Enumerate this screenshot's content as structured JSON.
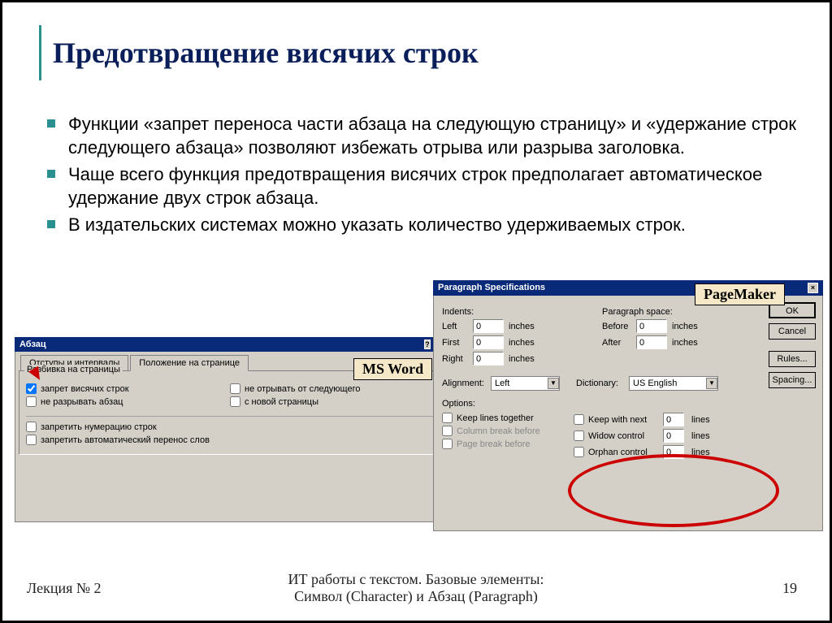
{
  "title": "Предотвращение висячих строк",
  "bullets": [
    "Функции «запрет переноса части абзаца на следующую страницу» и «удержание строк следующего абзаца» позволяют избежать отрыва или разрыва заголовка.",
    "Чаще всего функция предотвращения висячих строк предполагает автоматическое удержание двух строк абзаца.",
    "В издательских системах можно указать количество удерживаемых строк."
  ],
  "tags": {
    "msword": "MS Word",
    "pagemaker": "PageMaker"
  },
  "msword": {
    "window_title": "Абзац",
    "tabs": [
      "Отступы и интервалы",
      "Положение на странице"
    ],
    "group": "Разбивка на страницы",
    "chk": {
      "widow": "запрет висячих строк",
      "keep_together": "не разрывать абзац",
      "keep_next": "не отрывать от следующего",
      "page_break": "с новой страницы",
      "suppress_num": "запретить нумерацию строк",
      "no_hyphen": "запретить автоматический перенос слов"
    }
  },
  "pm": {
    "window_title": "Paragraph Specifications",
    "labels": {
      "indents": "Indents:",
      "para_space": "Paragraph space:",
      "left": "Left",
      "first": "First",
      "right": "Right",
      "before": "Before",
      "after": "After",
      "inches": "inches",
      "alignment": "Alignment:",
      "dictionary": "Dictionary:",
      "options": "Options:",
      "keep_lines": "Keep lines together",
      "col_break": "Column break before",
      "page_break": "Page break before",
      "keep_next": "Keep with next",
      "widow": "Widow control",
      "orphan": "Orphan control",
      "lines": "lines"
    },
    "values": {
      "left": "0",
      "first": "0",
      "right": "0",
      "before": "0",
      "after": "0",
      "alignment": "Left",
      "dictionary": "US English",
      "keep_next": "0",
      "widow": "0",
      "orphan": "0"
    },
    "buttons": {
      "ok": "OK",
      "cancel": "Cancel",
      "rules": "Rules...",
      "spacing": "Spacing..."
    }
  },
  "footer": {
    "left": "Лекция № 2",
    "center1": "ИТ работы с текстом. Базовые элементы:",
    "center2": "Символ (Character)  и Абзац (Paragraph)",
    "page": "19"
  }
}
